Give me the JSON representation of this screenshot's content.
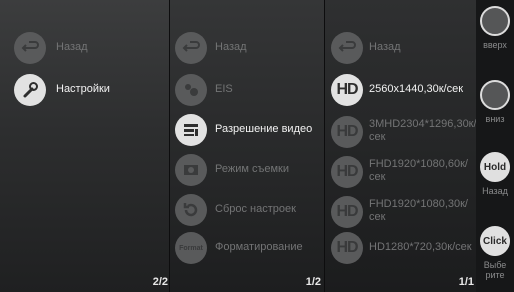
{
  "panel1": {
    "items": [
      {
        "label": "Назад"
      },
      {
        "label": "Настройки"
      }
    ],
    "page": "2/2"
  },
  "panel2": {
    "items": [
      {
        "label": "Назад"
      },
      {
        "label": "EIS"
      },
      {
        "label": "Разрешение видео"
      },
      {
        "label": "Режим съемки"
      },
      {
        "label": "Сброс настроек"
      },
      {
        "label": "Форматирование"
      }
    ],
    "format_icon_text": "Format",
    "page": "1/2"
  },
  "panel3": {
    "hd_icon_text": "HD",
    "items": [
      {
        "label": "Назад"
      },
      {
        "label": "2560x1440,30к/сек"
      },
      {
        "label": "3MHD2304*1296,30к/сек"
      },
      {
        "label": "FHD1920*1080,60к/сек"
      },
      {
        "label": "FHD1920*1080,30к/сек"
      },
      {
        "label": "HD1280*720,30к/сек"
      }
    ],
    "page": "1/1"
  },
  "sidebar": {
    "up_label": "вверх",
    "down_label": "вниз",
    "hold_text": "Hold",
    "back_label": "Назад",
    "click_text": "Click",
    "select_label": "Выбе рите"
  }
}
